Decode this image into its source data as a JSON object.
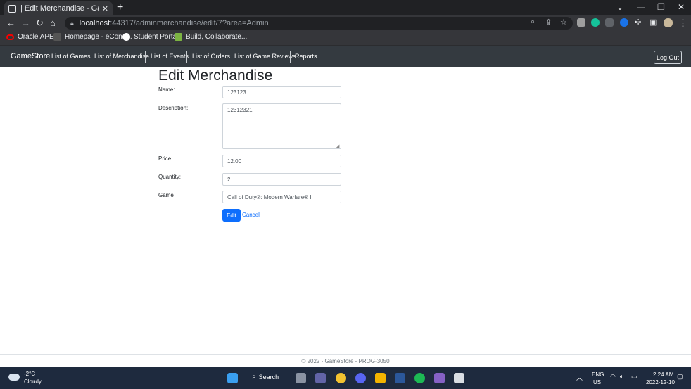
{
  "browser": {
    "tab_title": "| Edit Merchandise - GameStore",
    "tab_close": "✕",
    "new_tab": "+",
    "url_host": "localhost",
    "url_rest": ":44317/adminmerchandise/edit/7?area=Admin",
    "bookmarks": [
      {
        "label": "Oracle APEX",
        "icon": "oracle-icon",
        "color": "#f80000"
      },
      {
        "label": "Homepage - eCone...",
        "icon": "dbl-icon",
        "color": "#555555"
      },
      {
        "label": "Student Portal",
        "icon": "portal-icon",
        "color": "#ffffff"
      },
      {
        "label": "Build, Collaborate...",
        "icon": "build-icon",
        "color": "#7cb342"
      }
    ]
  },
  "app": {
    "brand": "GameStore",
    "nav": [
      "List of Games",
      "List of Merchandise",
      "List of Events",
      "List of Orders",
      "List of Game Reviews",
      "Reports"
    ],
    "logout_label": "Log Out"
  },
  "form": {
    "title": "Edit Merchandise",
    "name_label": "Name:",
    "name_value": "123123",
    "description_label": "Description:",
    "description_value": "12312321",
    "price_label": "Price:",
    "price_value": "12.00",
    "quantity_label": "Quantity:",
    "quantity_value": "2",
    "game_label": "Game",
    "game_value": "Call of Duty®: Modern Warfare® II",
    "edit_button": "Edit",
    "cancel_link": "Cancel"
  },
  "footer": {
    "text": "© 2022 - GameStore - PROG-3050"
  },
  "taskbar": {
    "temp": "-2°C",
    "condition": "Cloudy",
    "search_label": "Search",
    "lang_line1": "ENG",
    "lang_line2": "US",
    "time": "2:24 AM",
    "date": "2022-12-10"
  },
  "colors": {
    "navbar_bg": "#343a40",
    "primary": "#0d6efd",
    "taskbar_bg": "#1e2a3e"
  }
}
